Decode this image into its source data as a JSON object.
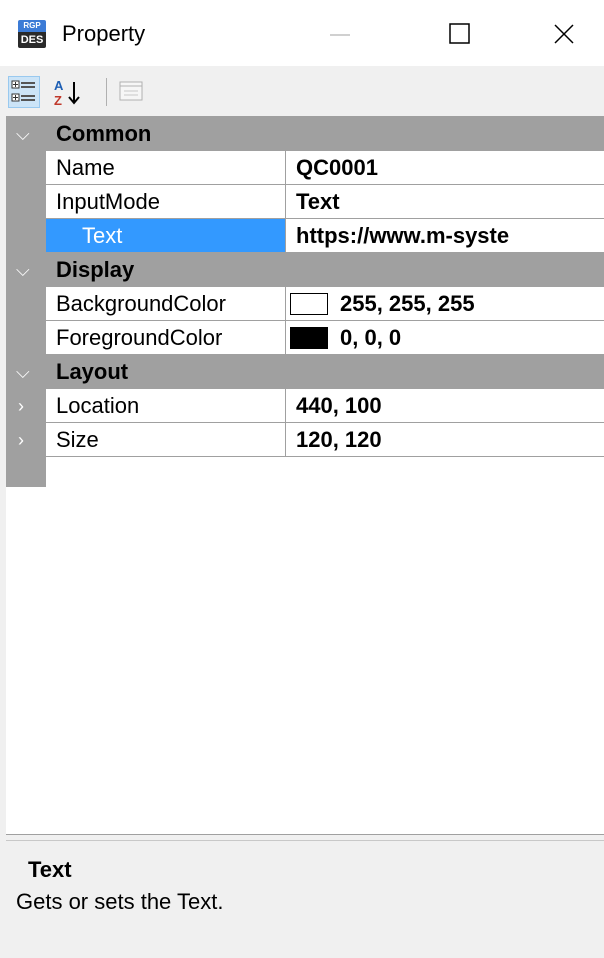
{
  "window": {
    "title": "Property",
    "icon_top_text": "RGP",
    "icon_bottom_text": "DES"
  },
  "toolbar": {
    "categorized_icon": "categorized-icon",
    "alphabetical_icon": "sort-az-icon",
    "property_pages_icon": "property-pages-icon"
  },
  "categories": [
    {
      "label": "Common",
      "properties": [
        {
          "name": "Name",
          "value": "QC0001"
        },
        {
          "name": "InputMode",
          "value": "Text"
        },
        {
          "name": "Text",
          "value": "https://www.m-syste",
          "selected": true
        }
      ]
    },
    {
      "label": "Display",
      "properties": [
        {
          "name": "BackgroundColor",
          "value": "255, 255, 255",
          "swatch": "#ffffff"
        },
        {
          "name": "ForegroundColor",
          "value": "0, 0, 0",
          "swatch": "#000000"
        }
      ]
    },
    {
      "label": "Layout",
      "properties": [
        {
          "name": "Location",
          "value": "440, 100",
          "expandable": true
        },
        {
          "name": "Size",
          "value": "120, 120",
          "expandable": true
        }
      ]
    }
  ],
  "description": {
    "title": "Text",
    "text": "Gets or sets the Text."
  },
  "colors": {
    "category_background": "#a0a0a0",
    "selection": "#3399ff",
    "window_background": "#f0f0f0"
  }
}
